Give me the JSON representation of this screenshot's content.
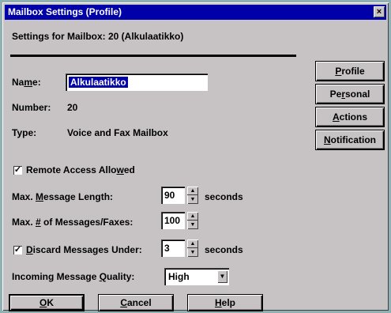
{
  "window": {
    "title": "Mailbox Settings (Profile)",
    "close_glyph": "×"
  },
  "header": {
    "settings_for": "Settings for Mailbox: 20 (Alkulaatikko)"
  },
  "fields": {
    "name_label_pre": "Na",
    "name_label_key": "m",
    "name_label_post": "e:",
    "name_value": "Alkulaatikko",
    "number_label": "Number:",
    "number_value": "20",
    "type_label": "Type:",
    "type_value": "Voice and Fax Mailbox"
  },
  "remote_access": {
    "checked": true,
    "check_glyph": "✓",
    "label_pre": "Remote Access Allo",
    "label_key": "w",
    "label_post": "ed"
  },
  "max_length": {
    "label_pre": "Max. ",
    "label_key": "M",
    "label_post": "essage Length:",
    "value": "90",
    "unit": "seconds"
  },
  "max_messages": {
    "label_pre": "Max. ",
    "label_key": "#",
    "label_post": " of Messages/Faxes:",
    "value": "100"
  },
  "discard": {
    "checked": true,
    "check_glyph": "✓",
    "label_pre": "",
    "label_key": "D",
    "label_post": "iscard Messages Under:",
    "value": "3",
    "unit": "seconds"
  },
  "quality": {
    "label_pre": "Incoming Message ",
    "label_key": "Q",
    "label_post": "uality:",
    "value": "High"
  },
  "tabs": [
    {
      "pre": "",
      "key": "P",
      "post": "rofile"
    },
    {
      "pre": "Pe",
      "key": "r",
      "post": "sonal"
    },
    {
      "pre": "",
      "key": "A",
      "post": "ctions"
    },
    {
      "pre": "",
      "key": "N",
      "post": "otification"
    }
  ],
  "buttons": {
    "ok": {
      "pre": "",
      "key": "O",
      "post": "K"
    },
    "cancel": {
      "pre": "",
      "key": "C",
      "post": "ancel"
    },
    "help": {
      "pre": "",
      "key": "H",
      "post": "elp"
    }
  },
  "glyphs": {
    "spin_up": "▲",
    "spin_down": "▼",
    "dropdown": "▼"
  },
  "colors": {
    "titlebar": "#0000a8",
    "dialog_face": "#c7c3c4",
    "desktop": "#8fb1b3"
  }
}
